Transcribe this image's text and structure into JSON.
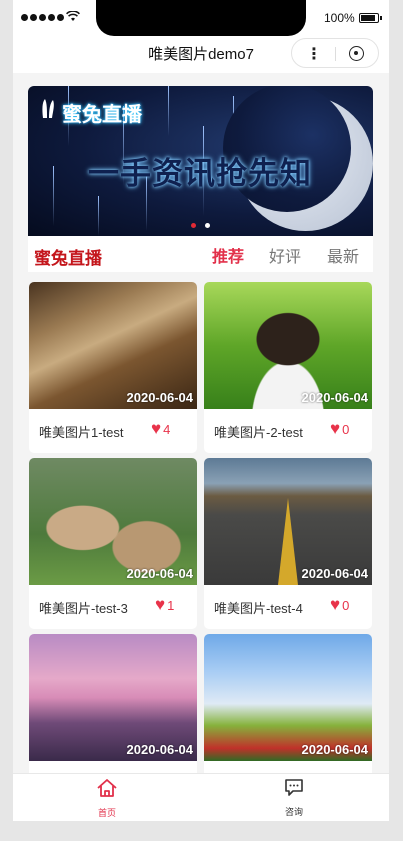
{
  "status_bar": {
    "battery": "100%"
  },
  "nav": {
    "title": "唯美图片demo7",
    "more": "⋮"
  },
  "banner": {
    "logo": "蜜兔直播",
    "slogan": "一手资讯抢先知",
    "dot_count": 2,
    "active_dot": 0
  },
  "tabs": {
    "brand": "蜜兔直播",
    "items": [
      {
        "label": "推荐",
        "active": true
      },
      {
        "label": "好评",
        "active": false
      },
      {
        "label": "最新",
        "active": false
      }
    ]
  },
  "cards": [
    {
      "title": "唯美图片1-test",
      "date": "2020-06-04",
      "likes": "4",
      "image": "book"
    },
    {
      "title": "唯美图片-2-test",
      "date": "2020-06-04",
      "likes": "0",
      "image": "girl-in-grass"
    },
    {
      "title": "唯美图片-test-3",
      "date": "2020-06-04",
      "likes": "1",
      "image": "rabbits"
    },
    {
      "title": "唯美图片-test-4",
      "date": "2020-06-04",
      "likes": "0",
      "image": "road"
    },
    {
      "title": "",
      "date": "2020-06-04",
      "likes": "",
      "image": "lake-boat"
    },
    {
      "title": "",
      "date": "2020-06-04",
      "likes": "",
      "image": "flower-field"
    }
  ],
  "bottom_tabs": [
    {
      "label": "首页",
      "icon": "home-icon",
      "active": true
    },
    {
      "label": "咨询",
      "icon": "chat-icon",
      "active": false
    }
  ],
  "colors": {
    "accent": "#e2304a",
    "brand_red": "#c4161c",
    "heart": "#e8334a"
  }
}
